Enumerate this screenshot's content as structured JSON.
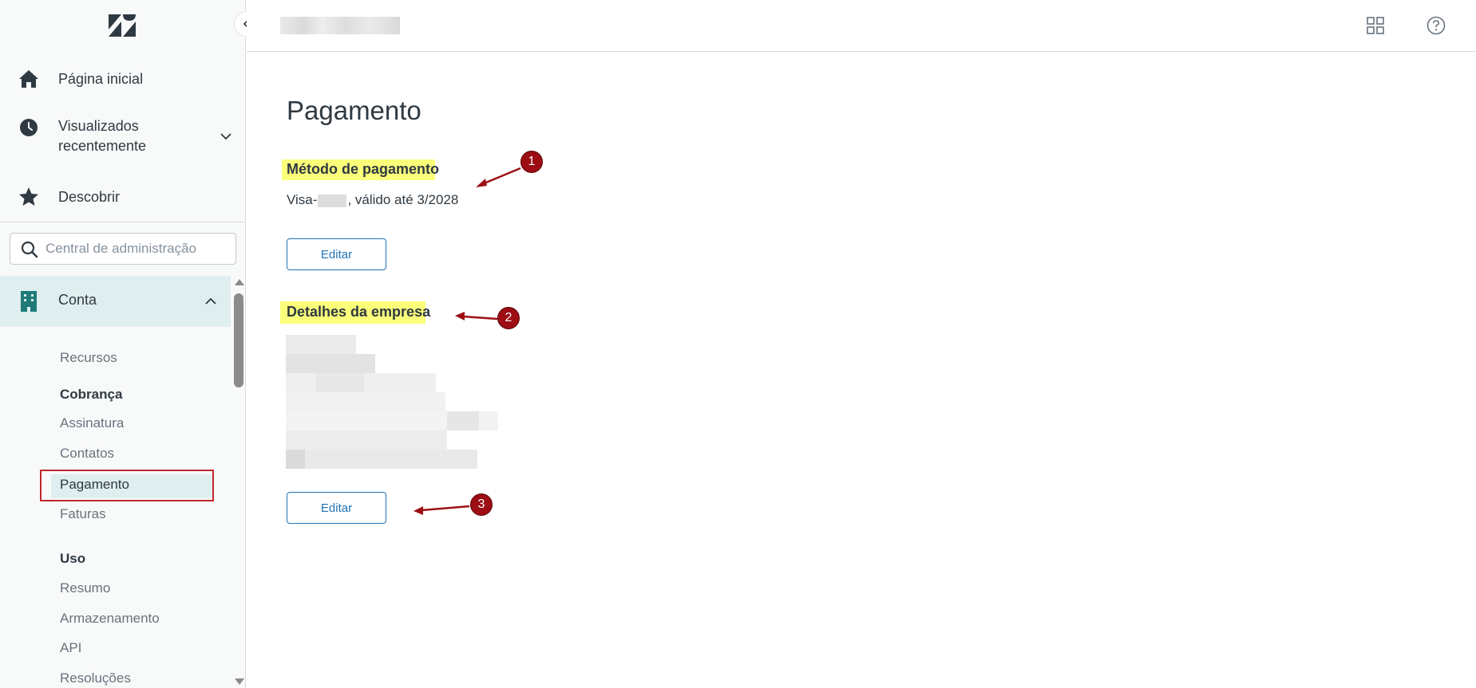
{
  "sidebar": {
    "nav": [
      {
        "label": "Página inicial",
        "icon": "home-icon"
      },
      {
        "label": "Visualizados recentemente",
        "icon": "clock-icon"
      },
      {
        "label": "Descobrir",
        "icon": "star-icon"
      }
    ],
    "recent_line1": "Visualizados",
    "recent_line2": "recentemente",
    "search_placeholder": "Central de administração",
    "section": {
      "label": "Conta",
      "icon": "building-icon"
    },
    "subitems": {
      "recursos": "Recursos",
      "cobranca": "Cobrança",
      "assinatura": "Assinatura",
      "contatos": "Contatos",
      "pagamento": "Pagamento",
      "faturas": "Faturas",
      "uso": "Uso",
      "resumo": "Resumo",
      "armazenamento": "Armazenamento",
      "api": "API",
      "resolucoes": "Resoluções"
    }
  },
  "header": {
    "icons": [
      "grid-icon",
      "help-icon"
    ]
  },
  "main": {
    "title": "Pagamento",
    "payment_method": {
      "heading": "Método de pagamento",
      "card_prefix": "Visa-",
      "card_suffix": ", válido até 3/2028",
      "edit_label": "Editar"
    },
    "company": {
      "heading": "Detalhes da empresa",
      "edit_label": "Editar"
    }
  },
  "annotations": [
    "1",
    "2",
    "3"
  ],
  "colors": {
    "accent": "#1f73b7",
    "highlight": "#fbff7a",
    "active_bg": "#dfeeee",
    "annotation": "#9c0e14"
  }
}
